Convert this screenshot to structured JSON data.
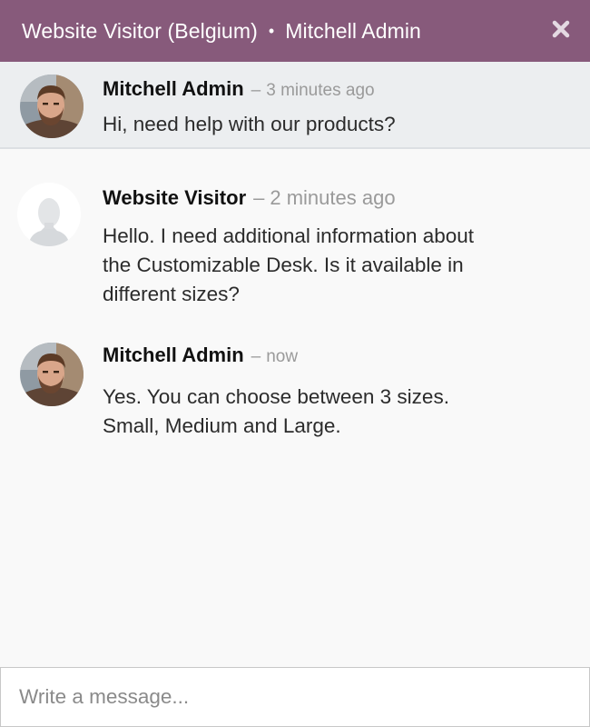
{
  "header": {
    "visitor": "Website Visitor (Belgium)",
    "separator": "•",
    "operator": "Mitchell Admin",
    "close_icon": "close-icon",
    "background_color": "#875a7b"
  },
  "pinned_message": {
    "author": "Mitchell Admin",
    "dash": "–",
    "time": "3 minutes ago",
    "text": "Hi, need help with our products?",
    "avatar_icon": "user-photo-avatar"
  },
  "messages": [
    {
      "author": "Website Visitor",
      "dash": "–",
      "time": "2 minutes ago",
      "lines": [
        "Hello. I need additional information about",
        "the Customizable Desk. Is it available in",
        "different sizes?"
      ],
      "avatar_icon": "default-user-avatar"
    },
    {
      "author": "Mitchell Admin",
      "dash": "–",
      "time": "now",
      "lines": [
        "Yes. You can choose between 3 sizes.",
        "Small, Medium and Large."
      ],
      "avatar_icon": "user-photo-avatar"
    }
  ],
  "composer": {
    "placeholder": "Write a message...",
    "value": ""
  }
}
